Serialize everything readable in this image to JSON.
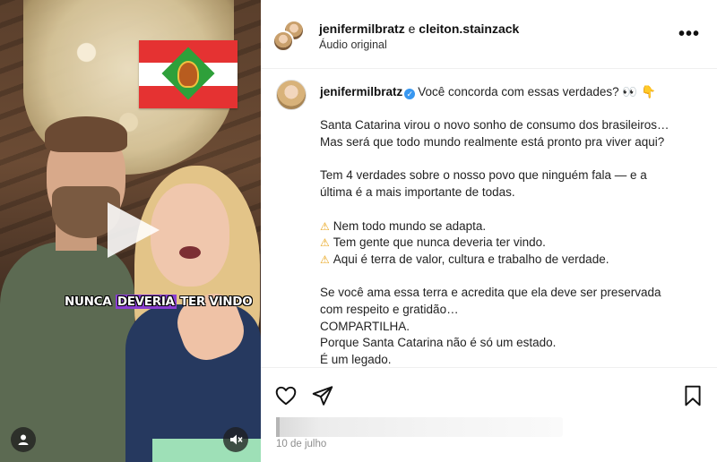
{
  "video": {
    "caption_prefix": "NUNCA ",
    "caption_highlight": "DEVERIA",
    "caption_suffix": " TER VINDO",
    "icons": {
      "play": "play-icon",
      "user_tags": "user-icon",
      "sound": "muted-speaker-icon"
    }
  },
  "header": {
    "user1": "jenifermilbratz",
    "conjunction": " e ",
    "user2": "cleiton.stainzack",
    "audio": "Áudio original",
    "more_label": "•••"
  },
  "caption": {
    "username": "jenifermilbratz",
    "intro": "Você concorda com essas verdades? 👀 👇",
    "p1": [
      "Santa Catarina virou o novo sonho de consumo dos brasileiros…",
      "Mas será que todo mundo realmente está pronto pra viver aqui?"
    ],
    "p2": [
      "Tem 4 verdades sobre o nosso povo que ninguém fala — e a",
      "última é a mais importante de todas."
    ],
    "list": [
      "Nem todo mundo se adapta.",
      "Tem gente que nunca deveria ter vindo.",
      "Aqui é terra de valor, cultura e trabalho de verdade."
    ],
    "p4": [
      "Se você ama essa terra e acredita que ela deve ser preservada",
      "com respeito e gratidão…",
      "COMPARTILHA.",
      "Porque Santa Catarina não é só um estado.",
      "É um legado."
    ]
  },
  "actions": {
    "icons": [
      "heart-icon",
      "share-icon",
      "bookmark-icon"
    ]
  },
  "date": "10 de julho",
  "colors": {
    "caption_highlight": "#8a3fd1",
    "verified": "#3897f0",
    "warning": "#e8a317"
  }
}
